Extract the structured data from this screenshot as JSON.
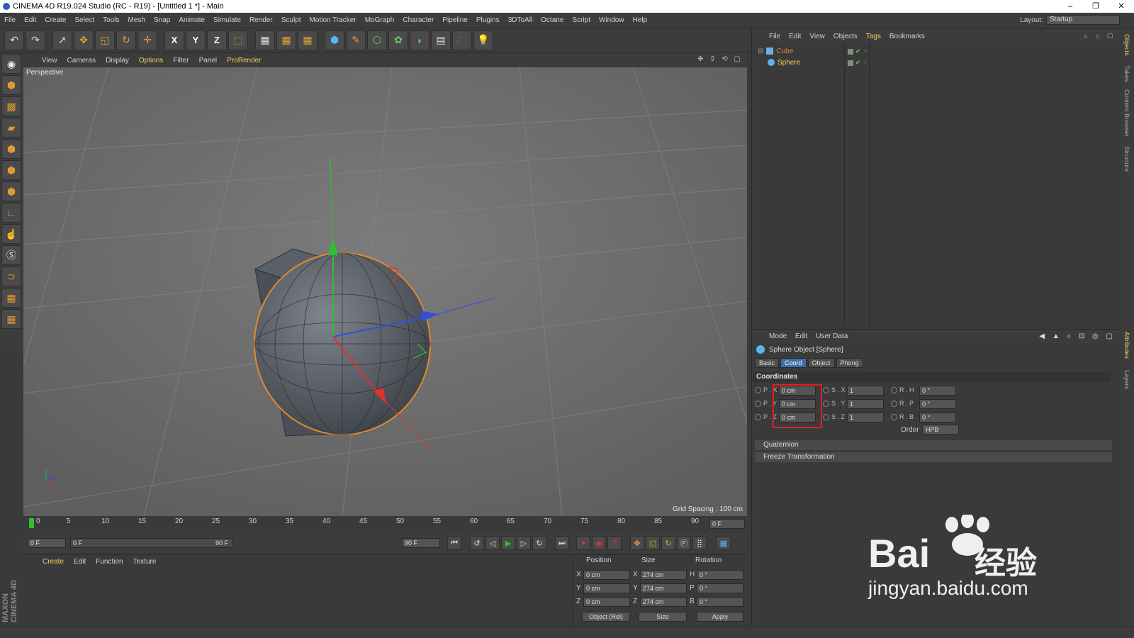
{
  "window": {
    "title": "CINEMA 4D R19.024 Studio (RC - R19) - [Untitled 1 *] - Main"
  },
  "menubar": [
    "File",
    "Edit",
    "Create",
    "Select",
    "Tools",
    "Mesh",
    "Snap",
    "Animate",
    "Simulate",
    "Render",
    "Sculpt",
    "Motion Tracker",
    "MoGraph",
    "Character",
    "Pipeline",
    "Plugins",
    "3DToAll",
    "Octane",
    "Script",
    "Window",
    "Help"
  ],
  "layout": {
    "label": "Layout:",
    "value": "Startup"
  },
  "toolbar": {
    "axis_x": "X",
    "axis_y": "Y",
    "axis_z": "Z"
  },
  "viewport": {
    "menu": [
      "View",
      "Cameras",
      "Display",
      "Options",
      "Filter",
      "Panel",
      "ProRender"
    ],
    "label": "Perspective",
    "grid_spacing": "Grid Spacing : 100 cm"
  },
  "timeline": {
    "ticks": [
      "0",
      "5",
      "10",
      "15",
      "20",
      "25",
      "30",
      "35",
      "40",
      "45",
      "50",
      "55",
      "60",
      "65",
      "70",
      "75",
      "80",
      "85",
      "90"
    ],
    "end_field": "0 F",
    "current_frame": "0 F",
    "range_start": "0 F",
    "range_end": "90 F",
    "max_frame": "90 F"
  },
  "material_manager": {
    "menu": [
      "Create",
      "Edit",
      "Function",
      "Texture"
    ],
    "brand": "MAXON CINEMA 4D"
  },
  "coord_manager": {
    "headers": {
      "position": "Position",
      "size": "Size",
      "rotation": "Rotation"
    },
    "rows": [
      {
        "axis": "X",
        "pos": "0 cm",
        "size_axis": "X",
        "size": "274 cm",
        "rot_axis": "H",
        "rot": "0 °"
      },
      {
        "axis": "Y",
        "pos": "0 cm",
        "size_axis": "Y",
        "size": "274 cm",
        "rot_axis": "P",
        "rot": "0 °"
      },
      {
        "axis": "Z",
        "pos": "0 cm",
        "size_axis": "Z",
        "size": "274 cm",
        "rot_axis": "B",
        "rot": "0 °"
      }
    ],
    "mode_select": "Object (Rel)",
    "size_select": "Size",
    "apply": "Apply"
  },
  "object_manager": {
    "menu": [
      "File",
      "Edit",
      "View",
      "Objects",
      "Tags",
      "Bookmarks"
    ],
    "objects": [
      {
        "name": "Cube"
      },
      {
        "name": "Sphere"
      }
    ]
  },
  "attribute_manager": {
    "menu": [
      "Mode",
      "Edit",
      "User Data"
    ],
    "title": "Sphere Object [Sphere]",
    "tabs": [
      "Basic",
      "Coord",
      "Object",
      "Phong"
    ],
    "active_tab": "Coord",
    "section": "Coordinates",
    "rows": [
      {
        "p_label": "P . X",
        "p_val": "0 cm",
        "s_label": "S . X",
        "s_val": "1",
        "r_label": "R . H",
        "r_val": "0 °"
      },
      {
        "p_label": "P . Y",
        "p_val": "0 cm",
        "s_label": "S . Y",
        "s_val": "1",
        "r_label": "R . P",
        "r_val": "0 °"
      },
      {
        "p_label": "P . Z",
        "p_val": "0 cm",
        "s_label": "S . Z",
        "s_val": "1",
        "r_label": "R . B",
        "r_val": "0 °"
      }
    ],
    "order_label": "Order",
    "order_value": "HPB",
    "collapsed": [
      "Quaternion",
      "Freeze Transformation"
    ]
  },
  "side_tabs": {
    "top": [
      "Objects",
      "Takes",
      "Content Browser",
      "Structure"
    ],
    "bottom": [
      "Attributes",
      "Layers"
    ]
  },
  "watermark": {
    "brand": "Bai",
    "cn": "经验",
    "url": "jingyan.baidu.com"
  },
  "colors": {
    "accent": "#f0d060",
    "highlight_box": "#e02020",
    "active_tab": "#3d6fa6"
  }
}
